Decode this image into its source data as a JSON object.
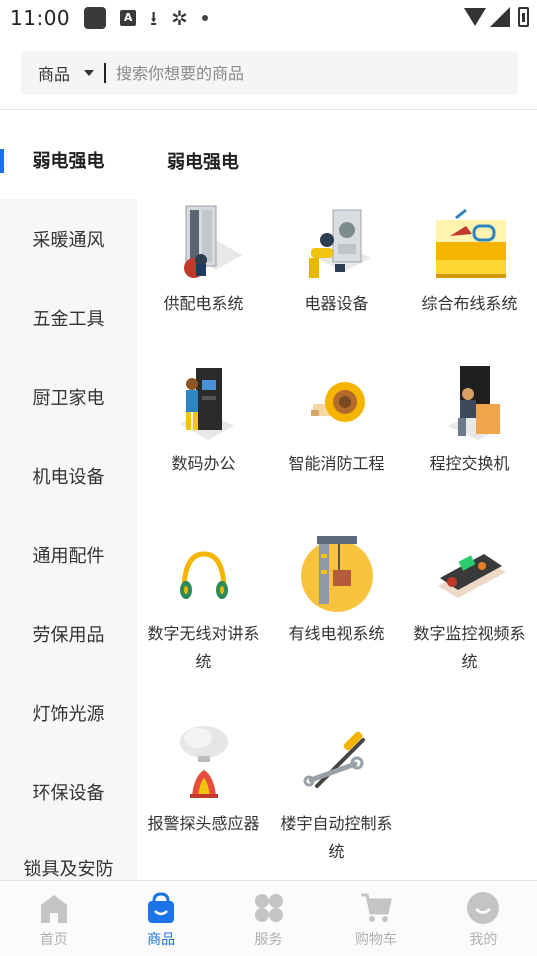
{
  "status_bar": {
    "time": "11:00",
    "notif_a_letter": "A"
  },
  "search": {
    "category": "商品",
    "placeholder": "搜索你想要的商品"
  },
  "sidebar": {
    "items": [
      {
        "label": "弱电强电",
        "active": true
      },
      {
        "label": "采暖通风"
      },
      {
        "label": "五金工具"
      },
      {
        "label": "厨卫家电"
      },
      {
        "label": "机电设备"
      },
      {
        "label": "通用配件"
      },
      {
        "label": "劳保用品"
      },
      {
        "label": "灯饰光源"
      },
      {
        "label": "环保设备"
      },
      {
        "label": "锁具及安防"
      }
    ]
  },
  "content": {
    "title": "弱电强电",
    "items": [
      {
        "label": "供配电系统",
        "icon": "power-distribution-icon"
      },
      {
        "label": "电器设备",
        "icon": "electrical-equipment-icon"
      },
      {
        "label": "综合布线系统",
        "icon": "cabling-toolbox-icon"
      },
      {
        "label": "数码办公",
        "icon": "digital-office-icon"
      },
      {
        "label": "智能消防工程",
        "icon": "measuring-tape-icon"
      },
      {
        "label": "程控交换机",
        "icon": "switchboard-icon"
      },
      {
        "label": "数字无线对讲系统",
        "icon": "headphones-icon"
      },
      {
        "label": "有线电视系统",
        "icon": "cable-tv-icon"
      },
      {
        "label": "数字监控视频系统",
        "icon": "video-surveillance-icon"
      },
      {
        "label": "报警探头感应器",
        "icon": "smoke-alarm-icon"
      },
      {
        "label": "楼宇自动控制系统",
        "icon": "building-control-tools-icon"
      }
    ]
  },
  "bottom_nav": {
    "items": [
      {
        "label": "首页",
        "icon": "home-icon"
      },
      {
        "label": "商品",
        "icon": "shopping-bag-icon",
        "active": true
      },
      {
        "label": "服务",
        "icon": "services-icon"
      },
      {
        "label": "购物车",
        "icon": "cart-icon"
      },
      {
        "label": "我的",
        "icon": "profile-icon"
      }
    ]
  },
  "colors": {
    "accent": "#1a73e8",
    "inactive": "#b0b0b0",
    "sidebar_bg": "#f7f7f7"
  }
}
